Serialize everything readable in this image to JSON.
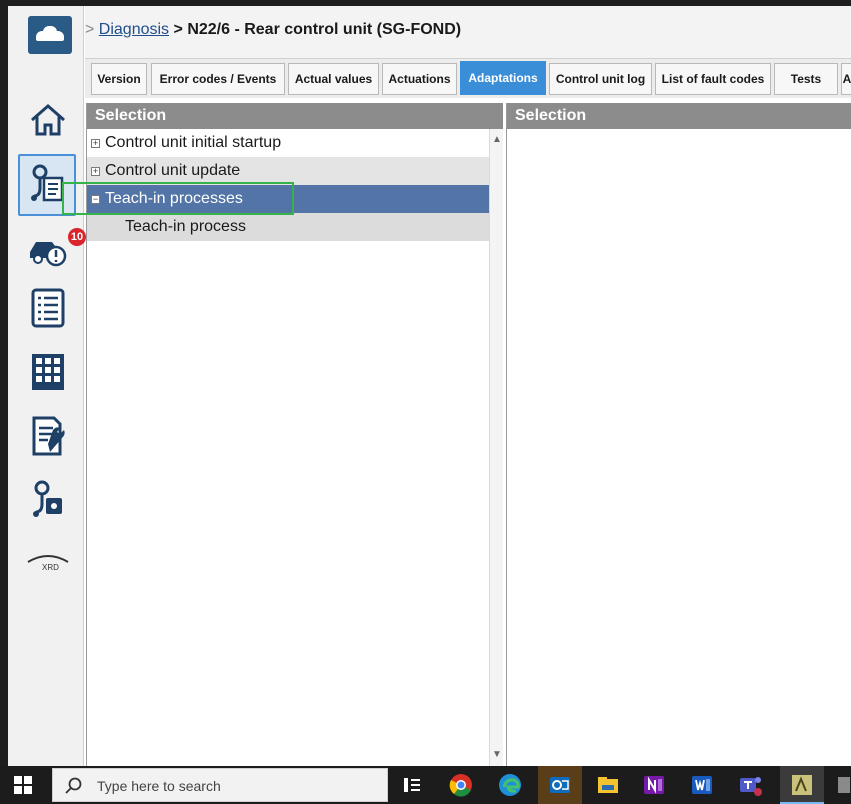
{
  "breadcrumb": {
    "separator": ">",
    "link": "Diagnosis",
    "arrow": ">",
    "title": "N22/6 - Rear control unit (SG-FOND)"
  },
  "tabs": [
    {
      "label": "Version",
      "active": false
    },
    {
      "label": "Error codes / Events",
      "active": false
    },
    {
      "label": "Actual values",
      "active": false
    },
    {
      "label": "Actuations",
      "active": false
    },
    {
      "label": "Adaptations",
      "active": true
    },
    {
      "label": "Control unit log",
      "active": false
    },
    {
      "label": "List of fault codes",
      "active": false
    },
    {
      "label": "Tests",
      "active": false
    },
    {
      "label": "A",
      "active": false
    }
  ],
  "sidebar": {
    "badge_count": "10",
    "xrd_label": "XRD",
    "icons": [
      "home-icon",
      "diagnosis-icon",
      "vehicle-alert-icon",
      "list-icon",
      "grid-icon",
      "document-wrench-icon",
      "diagnosis-lock-icon",
      "xrd-icon"
    ]
  },
  "left_panel": {
    "header": "Selection",
    "items": [
      {
        "label": "Control unit initial startup",
        "expander": "+"
      },
      {
        "label": "Control unit update",
        "expander": "+"
      },
      {
        "label": "Teach-in processes",
        "expander": "−"
      },
      {
        "label": "Teach-in process",
        "expander": ""
      }
    ]
  },
  "right_panel": {
    "header": "Selection"
  },
  "taskbar": {
    "search_placeholder": "Type here to search",
    "apps": [
      "task-view-icon",
      "chrome-icon",
      "edge-icon",
      "outlook-icon",
      "file-explorer-icon",
      "onenote-icon",
      "word-icon",
      "teams-icon",
      "diagnosis-app-icon"
    ]
  },
  "colors": {
    "tab_active": "#3a8ed8",
    "selected_row": "#5274a6",
    "highlight": "#35b34a",
    "panel_header": "#8c8c8c",
    "badge": "#d9262c"
  }
}
